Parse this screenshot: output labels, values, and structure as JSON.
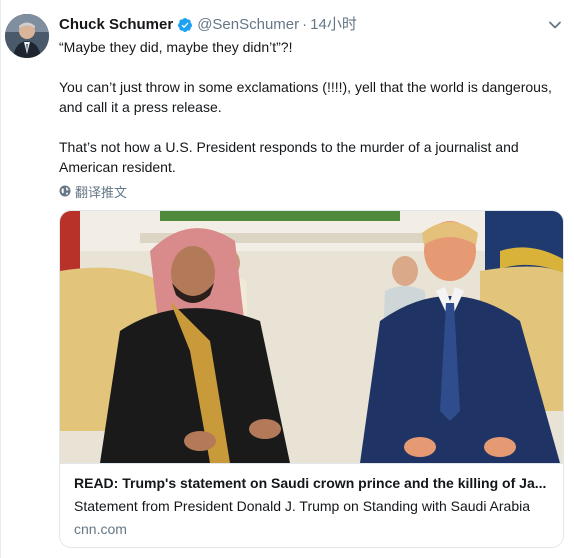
{
  "tweet": {
    "author_name": "Chuck Schumer",
    "author_handle": "@SenSchumer",
    "separator": "·",
    "timestamp": "14小时",
    "paragraphs": [
      "“Maybe they did, maybe they didn’t”?!",
      "You can’t just throw in some exclamations (!!!!), yell that the world is dangerous, and call it a press release.",
      "That’s not how a U.S. President responds to the murder of a journalist and American resident."
    ],
    "translate_label": "翻译推文"
  },
  "card": {
    "title": "READ: Trump's statement on Saudi crown prince and the killing of Ja...",
    "description": "Statement from President Donald J. Trump on Standing with Saudi Arabia",
    "domain": "cnn.com"
  },
  "icons": {
    "verified": "verified-badge-icon",
    "caret": "chevron-down-icon",
    "globe": "globe-icon"
  },
  "colors": {
    "verified_blue": "#1da1f2",
    "secondary_text": "#657786",
    "primary_text": "#14171a",
    "border": "#e1e8ed"
  }
}
